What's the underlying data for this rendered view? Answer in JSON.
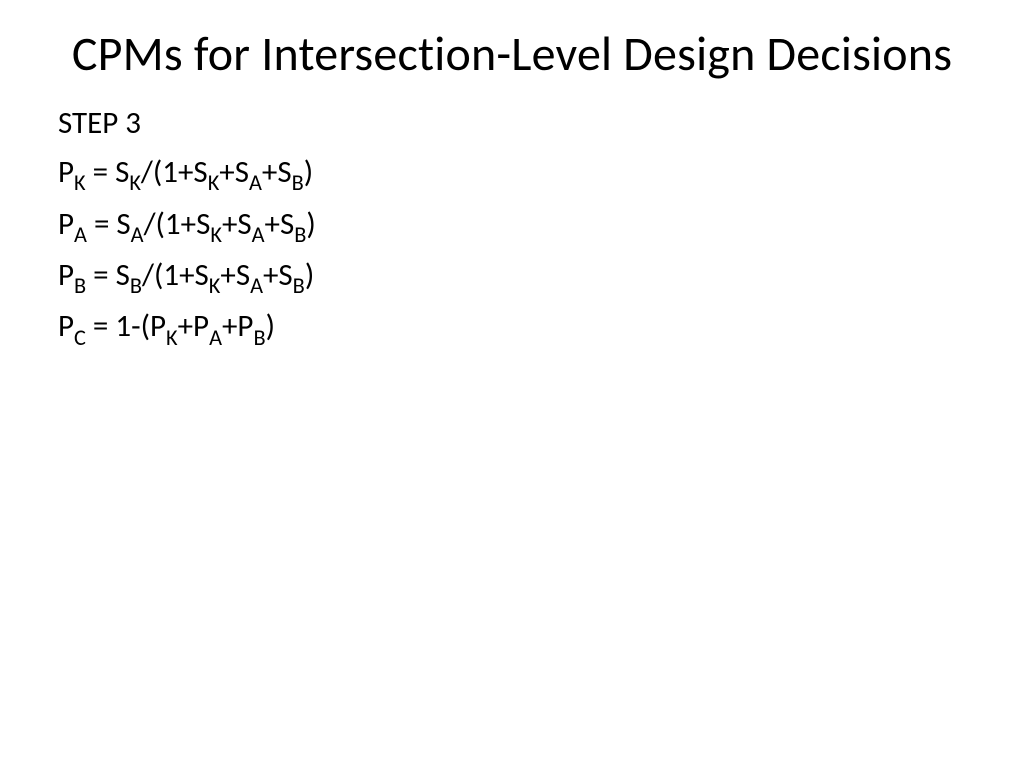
{
  "title": "CPMs for Intersection-Level Design Decisions",
  "step_label": "STEP 3",
  "equations": [
    {
      "lhs": "P",
      "lhs_sub": "K",
      "rhs_pre": " = S",
      "rhs_sub1": "K",
      "rhs_mid1": "/(1+S",
      "rhs_sub2": "K",
      "rhs_mid2": "+S",
      "rhs_sub3": "A",
      "rhs_mid3": "+S",
      "rhs_sub4": "B",
      "rhs_end": ")"
    },
    {
      "lhs": "P",
      "lhs_sub": "A",
      "rhs_pre": " = S",
      "rhs_sub1": "A",
      "rhs_mid1": "/(1+S",
      "rhs_sub2": "K",
      "rhs_mid2": "+S",
      "rhs_sub3": "A",
      "rhs_mid3": "+S",
      "rhs_sub4": "B",
      "rhs_end": ")"
    },
    {
      "lhs": "P",
      "lhs_sub": "B",
      "rhs_pre": " = S",
      "rhs_sub1": "B",
      "rhs_mid1": "/(1+S",
      "rhs_sub2": "K",
      "rhs_mid2": "+S",
      "rhs_sub3": "A",
      "rhs_mid3": "+S",
      "rhs_sub4": "B",
      "rhs_end": ")"
    }
  ],
  "equation_last": {
    "lhs": "P",
    "lhs_sub": "C",
    "rhs_pre": " = 1-(P",
    "rhs_sub1": "K",
    "rhs_mid1": "+P",
    "rhs_sub2": "A",
    "rhs_mid2": "+P",
    "rhs_sub3": "B",
    "rhs_end": ")"
  }
}
